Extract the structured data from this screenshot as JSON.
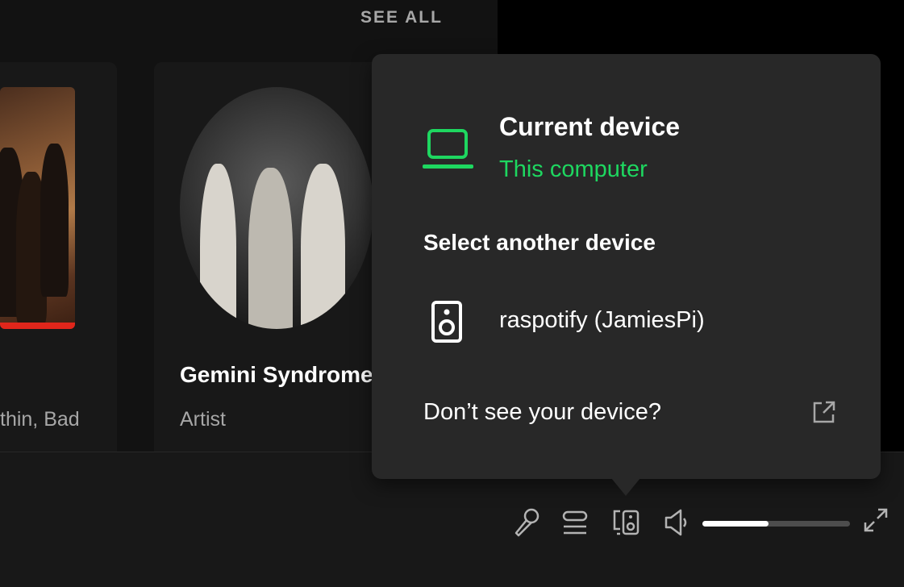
{
  "shelf": {
    "see_all": "SEE ALL",
    "cards": [
      {
        "subtitle": "thin, Bad"
      },
      {
        "title": "Gemini Syndrome",
        "subtitle": "Artist"
      }
    ]
  },
  "device_popup": {
    "current_heading": "Current device",
    "current_device": "This computer",
    "select_heading": "Select another device",
    "devices": [
      {
        "name": "raspotify (JamiesPi)",
        "icon": "speaker-icon"
      }
    ],
    "help_link": "Don’t see your device?",
    "help_icon": "external-link-icon"
  },
  "player_controls": {
    "icons": [
      "lyrics-mic-icon",
      "queue-icon",
      "connect-device-icon",
      "volume-icon",
      "fullscreen-icon"
    ],
    "volume_level": 0.45
  },
  "colors": {
    "accent": "#1ed760",
    "popup_bg": "#282828",
    "card_bg": "#181818",
    "muted_text": "#a7a7a7"
  }
}
